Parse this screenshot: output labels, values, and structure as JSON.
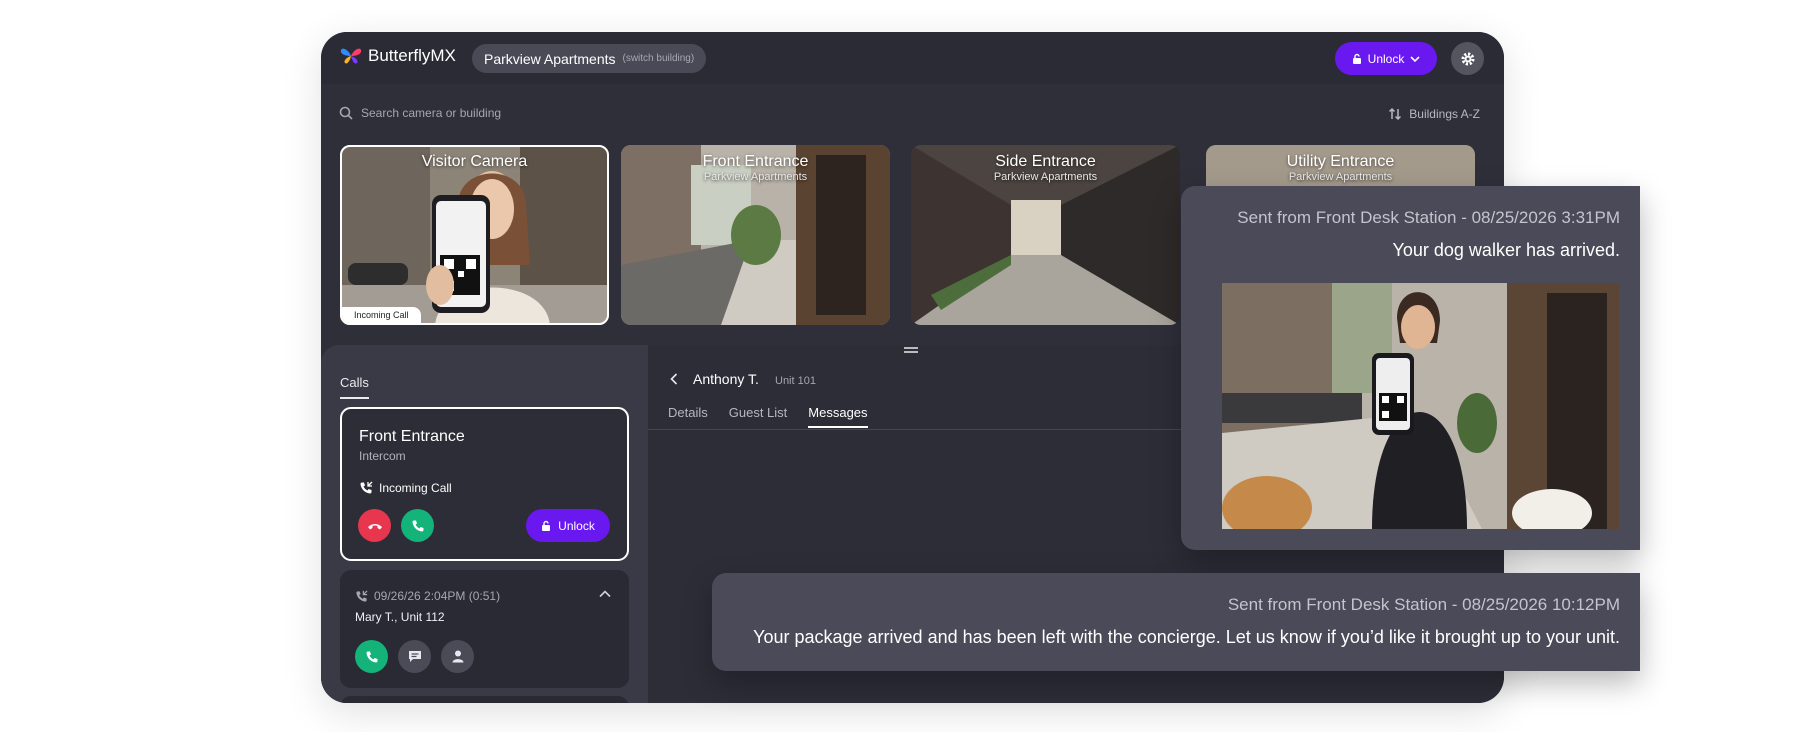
{
  "brand": {
    "name": "ButterflyMX"
  },
  "building": {
    "name": "Parkview Apartments",
    "switch_label": "(switch building)"
  },
  "header": {
    "unlock_label": "Unlock"
  },
  "search": {
    "placeholder": "Search camera or building"
  },
  "sort": {
    "label": "Buildings A-Z"
  },
  "cameras": [
    {
      "title": "Visitor Camera",
      "subtitle": "",
      "badge": "Incoming Call"
    },
    {
      "title": "Front Entrance",
      "subtitle": "Parkview Apartments"
    },
    {
      "title": "Side Entrance",
      "subtitle": "Parkview Apartments"
    },
    {
      "title": "Utility Entrance",
      "subtitle": "Parkview Apartments"
    }
  ],
  "calls": {
    "tab_label": "Calls",
    "active_call": {
      "location": "Front Entrance",
      "type": "Intercom",
      "status": "Incoming Call",
      "unlock_label": "Unlock"
    },
    "history": [
      {
        "meta": "09/26/26  2:04PM (0:51)",
        "caller": "Mary T., Unit 112"
      }
    ]
  },
  "conversation": {
    "name": "Anthony T.",
    "unit": "Unit 101",
    "tabs": [
      "Details",
      "Guest List",
      "Messages"
    ],
    "active_tab": "Messages"
  },
  "messages": [
    {
      "meta": "Sent from Front Desk Station - 08/25/2026 3:31PM",
      "text": "Your dog walker has arrived."
    },
    {
      "meta": "Sent from Front Desk Station - 08/25/2026 10:12PM",
      "text": "Your package arrived and has been left with the concierge. Let us know if you’d like it brought up to your unit."
    }
  ],
  "colors": {
    "accent": "#6a18f0",
    "decline": "#e8364f",
    "accept": "#14b37a",
    "panel": "#2f2f3a"
  },
  "icons": [
    "butterfly-logo-icon",
    "lock-icon",
    "chevron-down-icon",
    "gear-icon",
    "search-icon",
    "sort-icon",
    "phone-incoming-icon",
    "hangup-icon",
    "phone-icon",
    "message-icon",
    "person-icon",
    "chevron-up-icon",
    "back-icon"
  ]
}
